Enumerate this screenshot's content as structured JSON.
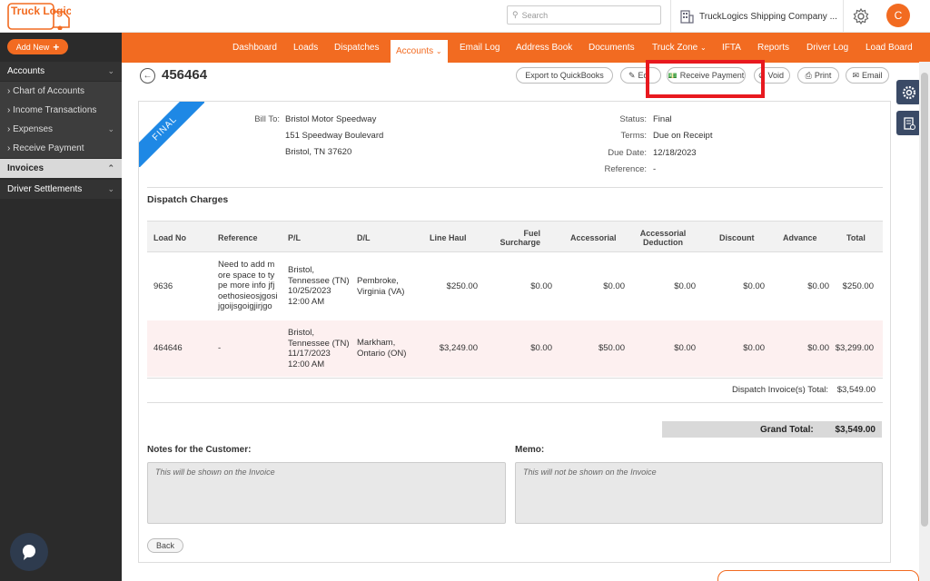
{
  "app": {
    "logo_text": "Truck Logics",
    "search_placeholder": "Search",
    "company": "TruckLogics Shipping Company ...",
    "avatar_letter": "C",
    "brand_color": "#f26b21"
  },
  "nav": {
    "items": [
      "Dashboard",
      "Loads",
      "Dispatches",
      "Accounts",
      "Email Log",
      "Address Book",
      "Documents",
      "Truck Zone",
      "IFTA",
      "Reports",
      "Driver Log",
      "Load Board"
    ]
  },
  "sidebar": {
    "add_new": "Add New",
    "accounts": "Accounts",
    "sub": [
      "Chart of Accounts",
      "Income Transactions",
      "Expenses",
      "Receive Payment"
    ],
    "invoices": "Invoices",
    "driver_settlements": "Driver Settlements"
  },
  "header": {
    "invoice_number": "456464",
    "buttons": {
      "export": "Export to QuickBooks",
      "edit": "Ed",
      "receive_payment": "Receive Payment",
      "void": "Void",
      "print": "Print",
      "email": "Email"
    }
  },
  "invoice": {
    "ribbon": "FINAL",
    "bill_to_label": "Bill To:",
    "bill_to": [
      "Bristol Motor Speedway",
      "151 Speedway Boulevard",
      "Bristol, TN 37620"
    ],
    "status_label": "Status:",
    "status": "Final",
    "terms_label": "Terms:",
    "terms": "Due on Receipt",
    "due_date_label": "Due Date:",
    "due_date": "12/18/2023",
    "reference_label": "Reference:",
    "reference": "-",
    "dispatch_charges_title": "Dispatch Charges",
    "columns": {
      "load_no": "Load No",
      "reference": "Reference",
      "pl": "P/L",
      "dl": "D/L",
      "line_haul": "Line Haul",
      "fuel_1": "Fuel",
      "fuel_2": "Surcharge",
      "accessorial": "Accessorial",
      "acc_ded_1": "Accessorial",
      "acc_ded_2": "Deduction",
      "discount": "Discount",
      "advance": "Advance",
      "total": "Total"
    },
    "rows": [
      {
        "load_no": "9636",
        "reference": [
          "Need to add m",
          "ore space to ty",
          "pe more info jfj",
          "oethosieosjgosi",
          "jgoijsgoigjirjgo"
        ],
        "pl": [
          "Bristol,",
          "Tennessee (TN)",
          "10/25/2023",
          "12:00 AM"
        ],
        "dl": [
          "Pembroke,",
          "Virginia (VA)"
        ],
        "line_haul": "$250.00",
        "fuel": "$0.00",
        "accessorial": "$0.00",
        "acc_ded": "$0.00",
        "discount": "$0.00",
        "advance": "$0.00",
        "total": "$250.00"
      },
      {
        "load_no": "464646",
        "reference": [
          "-"
        ],
        "pl": [
          "Bristol,",
          "Tennessee (TN)",
          "11/17/2023",
          "12:00 AM"
        ],
        "dl": [
          "Markham,",
          "Ontario (ON)"
        ],
        "line_haul": "$3,249.00",
        "fuel": "$0.00",
        "accessorial": "$50.00",
        "acc_ded": "$0.00",
        "discount": "$0.00",
        "advance": "$0.00",
        "total": "$3,299.00"
      }
    ],
    "dispatch_total_label": "Dispatch Invoice(s) Total:",
    "dispatch_total": "$3,549.00",
    "grand_total_label": "Grand Total:",
    "grand_total": "$3,549.00",
    "notes_label": "Notes for the Customer:",
    "notes_placeholder": "This will be shown on the Invoice",
    "memo_label": "Memo:",
    "memo_placeholder": "This will not be shown on the Invoice",
    "back": "Back"
  }
}
